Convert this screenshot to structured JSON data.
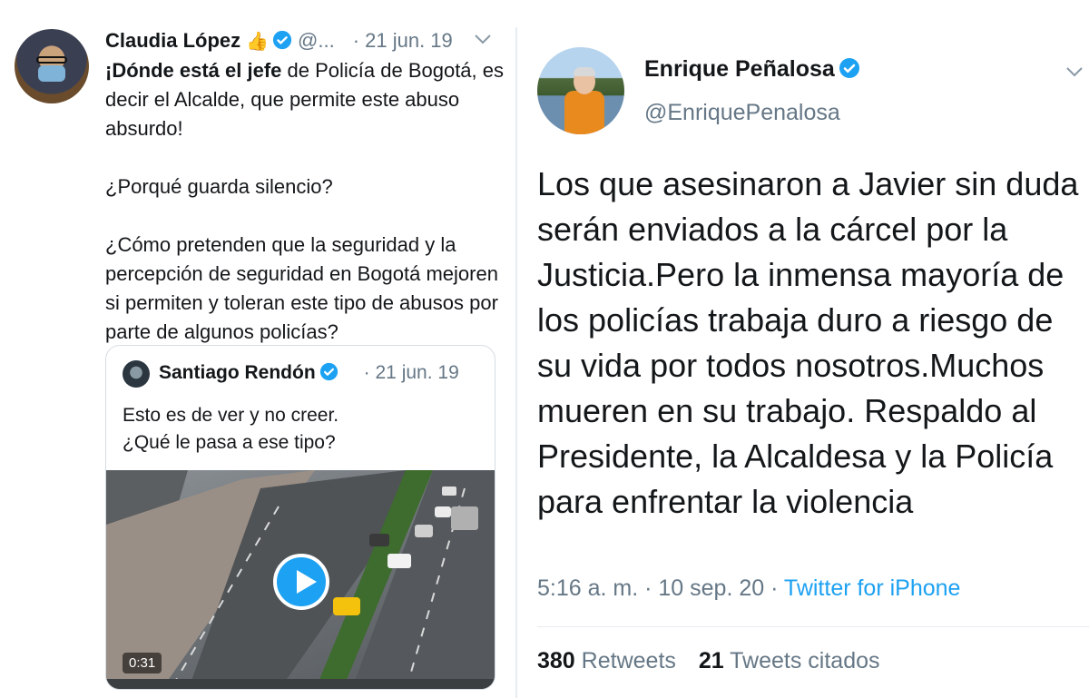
{
  "left_tweet": {
    "author_name": "Claudia López",
    "emoji": "👍",
    "handle": "@...",
    "date": "· 21 jun. 19",
    "text": {
      "bold_intro": "¡Dónde está el jefe",
      "intro_rest": " de Policía de Bogotá, es decir el Alcalde, que permite este abuso absurdo!",
      "para2": "¿Porqué guarda silencio?",
      "para3": "¿Cómo pretenden que la seguridad y la percepción de seguridad en Bogotá mejoren si permiten y toleran este tipo de abusos por parte de algunos policías?"
    },
    "quoted_tweet": {
      "author_name": "Santiago Rendón",
      "date": "· 21 jun. 19",
      "line1": "Esto es de ver y no creer.",
      "line2": "¿Qué le pasa a ese tipo?",
      "video_duration": "0:31"
    }
  },
  "right_tweet": {
    "author_name": "Enrique Peñalosa",
    "handle": "@EnriquePenalosa",
    "text": "Los que asesinaron a Javier sin duda serán enviados a la cárcel por la Justicia.Pero la inmensa mayoría de los policías trabaja duro a riesgo de su vida por todos nosotros.Muchos mueren en su trabajo. Respaldo al Presidente, la Alcaldesa y la Policía para enfrentar la violencia",
    "time": "5:16 a. m. · 10 sep. 20 · ",
    "source": "Twitter for iPhone",
    "retweets_count": "380",
    "retweets_label": "Retweets",
    "quotes_count": "21",
    "quotes_label": "Tweets citados"
  },
  "colors": {
    "text": "#14171a",
    "muted": "#657786",
    "accent": "#1da1f2",
    "border": "#d6dde3"
  }
}
